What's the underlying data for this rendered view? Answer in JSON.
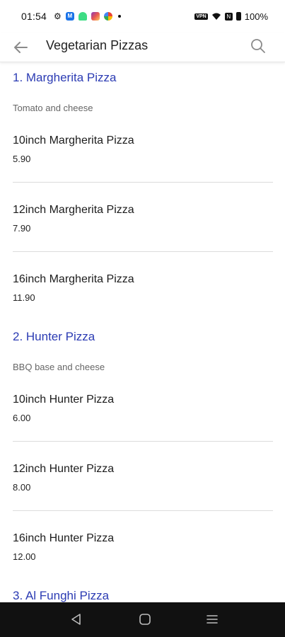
{
  "status_bar": {
    "time": "01:54",
    "battery_text": "100%",
    "vpn_label": "VPN"
  },
  "app_bar": {
    "title": "Vegetarian Pizzas",
    "back_icon": "arrow-left-icon",
    "search_icon": "search-icon"
  },
  "sections": [
    {
      "title": "1. Margherita Pizza",
      "description": "Tomato and cheese",
      "items": [
        {
          "name": "10inch Margherita Pizza",
          "price": "5.90"
        },
        {
          "name": "12inch Margherita Pizza",
          "price": "7.90"
        },
        {
          "name": "16inch Margherita Pizza",
          "price": "11.90"
        }
      ]
    },
    {
      "title": "2. Hunter Pizza",
      "description": "BBQ base and cheese",
      "items": [
        {
          "name": "10inch Hunter Pizza",
          "price": "6.00"
        },
        {
          "name": "12inch Hunter Pizza",
          "price": "8.00"
        },
        {
          "name": "16inch Hunter Pizza",
          "price": "12.00"
        }
      ]
    },
    {
      "title": "3. Al Funghi Pizza"
    }
  ],
  "colors": {
    "section_title": "#2b3bb3",
    "divider": "#dcdcdc",
    "nav_bar": "#111111"
  }
}
